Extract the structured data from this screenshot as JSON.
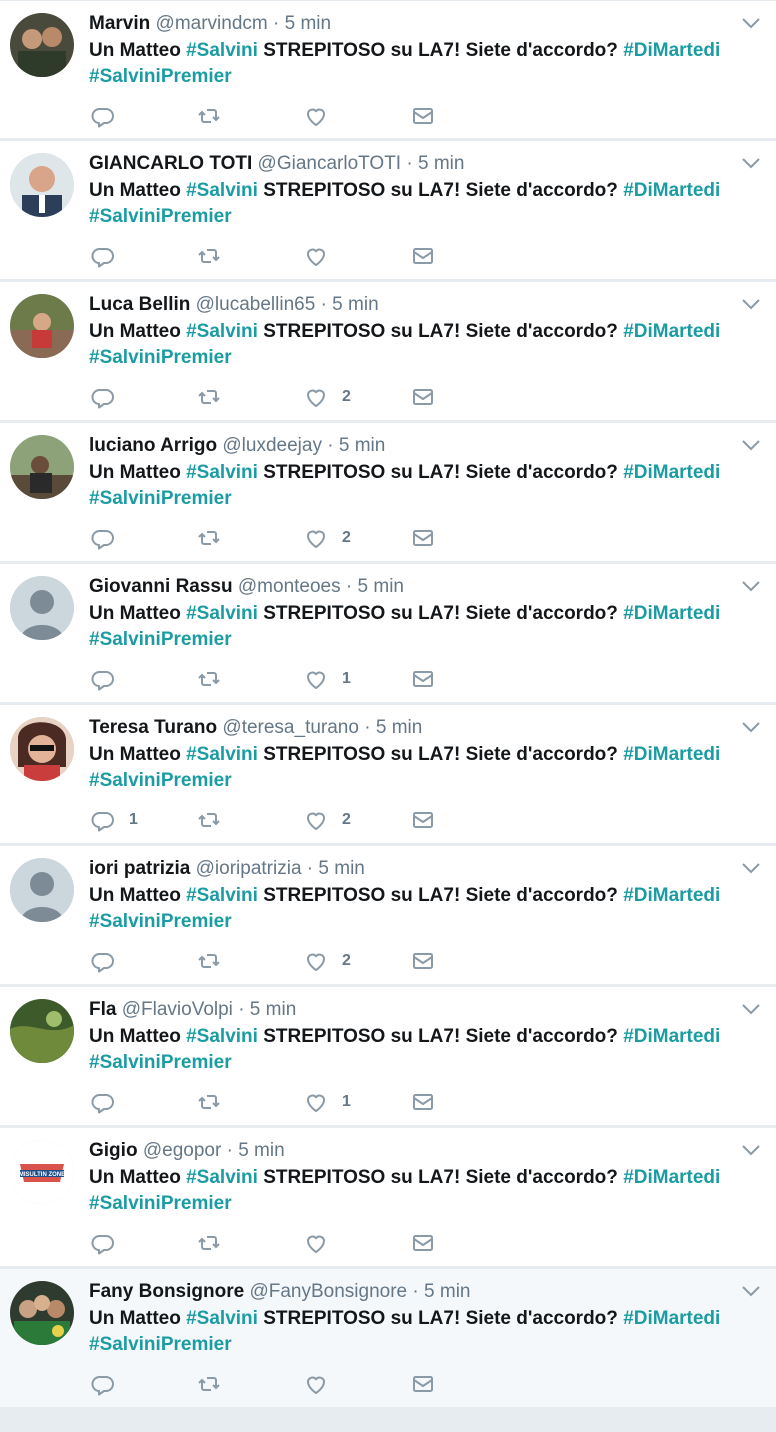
{
  "colors": {
    "hashtag": "#1b9ca3",
    "muted": "#657786",
    "icon": "#8a9aa6"
  },
  "icons": {
    "reply": "reply-icon",
    "retweet": "retweet-icon",
    "like": "heart-icon",
    "dm": "mail-icon",
    "menu": "chevron-down-icon"
  },
  "tweets": [
    {
      "name": "Marvin",
      "handle": "@marvindcm",
      "dot": "·",
      "time": "5 min",
      "text_a": "Un Matteo ",
      "tag_a": "#Salvini",
      "text_b": " STREPITOSO su LA7! Siete d'accordo? ",
      "tag_b": "#DiMartedi",
      "tag_c": "#SalviniPremier",
      "replies": "",
      "retweets": "",
      "likes": ""
    },
    {
      "name": "GIANCARLO TOTI",
      "handle": "@GiancarloTOTI",
      "dot": "·",
      "time": "5 min",
      "text_a": "Un Matteo ",
      "tag_a": "#Salvini",
      "text_b": " STREPITOSO su LA7! Siete d'accordo? ",
      "tag_b": "#DiMartedi",
      "tag_c": "#SalviniPremier",
      "replies": "",
      "retweets": "",
      "likes": ""
    },
    {
      "name": "Luca Bellin",
      "handle": "@lucabellin65",
      "dot": "·",
      "time": "5 min",
      "text_a": "Un Matteo ",
      "tag_a": "#Salvini",
      "text_b": " STREPITOSO su LA7! Siete d'accordo? ",
      "tag_b": "#DiMartedi",
      "tag_c": "#SalviniPremier",
      "replies": "",
      "retweets": "",
      "likes": "2"
    },
    {
      "name": "luciano Arrigo",
      "handle": "@luxdeejay",
      "dot": "·",
      "time": "5 min",
      "text_a": "Un Matteo ",
      "tag_a": "#Salvini",
      "text_b": " STREPITOSO su LA7! Siete d'accordo? ",
      "tag_b": "#DiMartedi",
      "tag_c": "#SalviniPremier",
      "replies": "",
      "retweets": "",
      "likes": "2"
    },
    {
      "name": "Giovanni Rassu",
      "handle": "@monteoes",
      "dot": "·",
      "time": "5 min",
      "text_a": "Un Matteo ",
      "tag_a": "#Salvini",
      "text_b": " STREPITOSO su LA7! Siete d'accordo? ",
      "tag_b": "#DiMartedi",
      "tag_c": "#SalviniPremier",
      "replies": "",
      "retweets": "",
      "likes": "1"
    },
    {
      "name": "Teresa Turano",
      "handle": "@teresa_turano",
      "dot": "·",
      "time": "5 min",
      "text_a": "Un Matteo ",
      "tag_a": "#Salvini",
      "text_b": " STREPITOSO su LA7! Siete d'accordo? ",
      "tag_b": "#DiMartedi",
      "tag_c": "#SalviniPremier",
      "replies": "1",
      "retweets": "",
      "likes": "2"
    },
    {
      "name": "iori patrizia",
      "handle": "@ioripatrizia",
      "dot": "·",
      "time": "5 min",
      "text_a": "Un Matteo ",
      "tag_a": "#Salvini",
      "text_b": " STREPITOSO su LA7! Siete d'accordo? ",
      "tag_b": "#DiMartedi",
      "tag_c": "#SalviniPremier",
      "replies": "",
      "retweets": "",
      "likes": "2"
    },
    {
      "name": "Fla",
      "handle": "@FlavioVolpi",
      "dot": "·",
      "time": "5 min",
      "text_a": "Un Matteo ",
      "tag_a": "#Salvini",
      "text_b": " STREPITOSO su LA7! Siete d'accordo? ",
      "tag_b": "#DiMartedi",
      "tag_c": "#SalviniPremier",
      "replies": "",
      "retweets": "",
      "likes": "1"
    },
    {
      "name": "Gigio",
      "handle": "@egopor",
      "dot": "·",
      "time": "5 min",
      "text_a": "Un Matteo ",
      "tag_a": "#Salvini",
      "text_b": " STREPITOSO su LA7! Siete d'accordo? ",
      "tag_b": "#DiMartedi",
      "tag_c": "#SalviniPremier",
      "replies": "",
      "retweets": "",
      "likes": "",
      "avatar_text": "MISULTIN ZONE"
    },
    {
      "name": "Fany Bonsignore",
      "handle": "@FanyBonsignore",
      "dot": "·",
      "time": "5 min",
      "text_a": "Un Matteo ",
      "tag_a": "#Salvini",
      "text_b": " STREPITOSO su LA7! Siete d'accordo? ",
      "tag_b": "#DiMartedi",
      "tag_c": "#SalviniPremier",
      "replies": "",
      "retweets": "",
      "likes": ""
    }
  ]
}
